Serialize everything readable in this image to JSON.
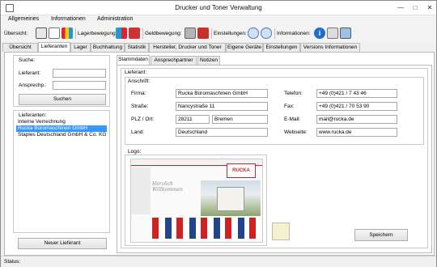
{
  "window": {
    "title": "Drucker und Toner Verwaltung"
  },
  "menu": [
    "Allgemeines",
    "Informationen",
    "Administration"
  ],
  "toolbar": {
    "overview_label": "Übersicht:",
    "stock_label": "Lagerbewegung:",
    "money_label": "Geldbewegung:",
    "settings_label": "Einstellungen:",
    "info_label": "Informationen:"
  },
  "tabs": [
    "Übersicht",
    "Lieferanten",
    "Lager",
    "Buchhaltung",
    "Statistik",
    "Hersteller, Drucker und Toner",
    "Eigene Geräte",
    "Einstellungen",
    "Versions Informationen"
  ],
  "search": {
    "title": "Suche:",
    "supplier_label": "Lieferant:",
    "supplier_value": "",
    "contact_label": "Ansprechp.:",
    "contact_value": "",
    "button": "Suchen"
  },
  "suppliers": {
    "title": "Lieferanten:",
    "items": [
      "Interne Verrechnung",
      "Rucka Büromaschinen GmbH",
      "Staples Deutschland GmbH & Co. KG"
    ],
    "selected_index": 1,
    "new_button": "Neuer Lieferant"
  },
  "subtabs": [
    "Stammdaten",
    "Ansprechpartner",
    "Notizen"
  ],
  "details": {
    "group_title": "Lieferant:",
    "address_title": "Anschrift:",
    "firma_label": "Firma:",
    "firma_value": "Rucka Büromaschinen GmbH",
    "strasse_label": "Straße:",
    "strasse_value": "Nancystraße 11",
    "plz_label": "PLZ / Ort:",
    "plz_value": "28211",
    "ort_value": "Bremen",
    "land_label": "Land:",
    "land_value": "Deutschland",
    "telefon_label": "Telefon:",
    "telefon_value": "+49 (0)421 / 7 43 46",
    "fax_label": "Fax:",
    "fax_value": "+49 (0)421 / 70 53 90",
    "email_label": "E-Mail:",
    "email_value": "mail@rucka.de",
    "web_label": "Webseite:",
    "web_value": "www.rucka.de",
    "logo_title": "Logo:",
    "logo_brand": "RUCKA",
    "logo_greeting": "Herzlich Willkommen",
    "save_button": "Speichern"
  },
  "status": {
    "label": "Status:"
  },
  "colors": {
    "selection": "#3399ff",
    "accent_red": "#c0262b"
  }
}
